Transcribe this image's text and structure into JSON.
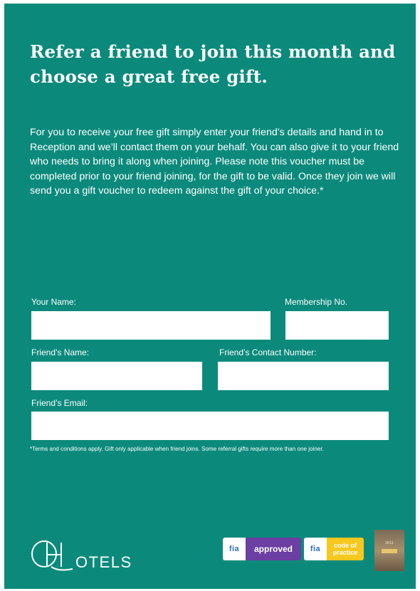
{
  "headline": "Refer a friend to join this month and choose a great free gift.",
  "intro": "For you to receive your free gift simply enter your friend’s details and hand in to Reception and we’ll contact them on your behalf. You can also give it to your friend who needs to bring it along when joining. Please note this voucher must be completed prior to your friend joining, for the gift to be valid. Once they join we will send you a gift voucher to redeem against the gift of your choice.*",
  "form": {
    "your_name_label": "Your Name:",
    "membership_label": "Membership No.",
    "friend_name_label": "Friend’s Name:",
    "friend_contact_label": "Friend’s Contact Number:",
    "friend_email_label": "Friend’s Email:",
    "your_name_value": "",
    "membership_value": "",
    "friend_name_value": "",
    "friend_contact_value": "",
    "friend_email_value": ""
  },
  "terms": "*Terms and conditions apply. Gift only applicable when friend joins. Some referral gifts require more than one joiner.",
  "logo": {
    "text": "OTELS",
    "icon": "qhotels-monogram-icon"
  },
  "badges": {
    "fia": "fia",
    "approved": "approved",
    "code_line1": "code of",
    "code_line2": "practice",
    "award_line1": "2011",
    "award_icon": "award-plaque-icon"
  },
  "colors": {
    "background": "#0b8a7c",
    "text": "#ffffff",
    "approved_purple": "#6c3fa3",
    "code_yellow": "#f7c81e",
    "fia_blue": "#2a6fc0"
  }
}
